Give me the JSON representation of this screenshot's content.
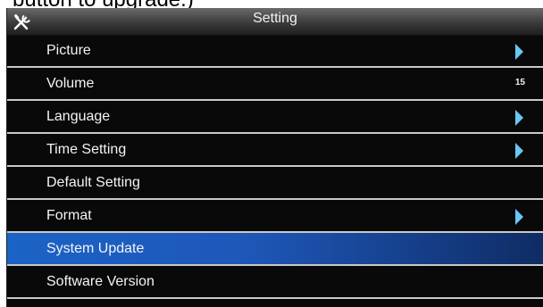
{
  "caption": "button to upgrade.)",
  "window": {
    "title": "Setting",
    "title_icon": "tools-icon"
  },
  "menu": {
    "items": [
      {
        "label": "Picture",
        "indicator": "arrow"
      },
      {
        "label": "Volume",
        "value": "15"
      },
      {
        "label": "Language",
        "indicator": "arrow"
      },
      {
        "label": "Time Setting",
        "indicator": "arrow"
      },
      {
        "label": "Default Setting"
      },
      {
        "label": "Format",
        "indicator": "arrow"
      },
      {
        "label": "System Update",
        "selected": true
      },
      {
        "label": "Software Version"
      }
    ]
  },
  "colors": {
    "panel_background": "#090909",
    "selection_blue": "#1b63c6",
    "arrow_blue": "#6bc6f2",
    "separator": "#c9c9c9"
  }
}
